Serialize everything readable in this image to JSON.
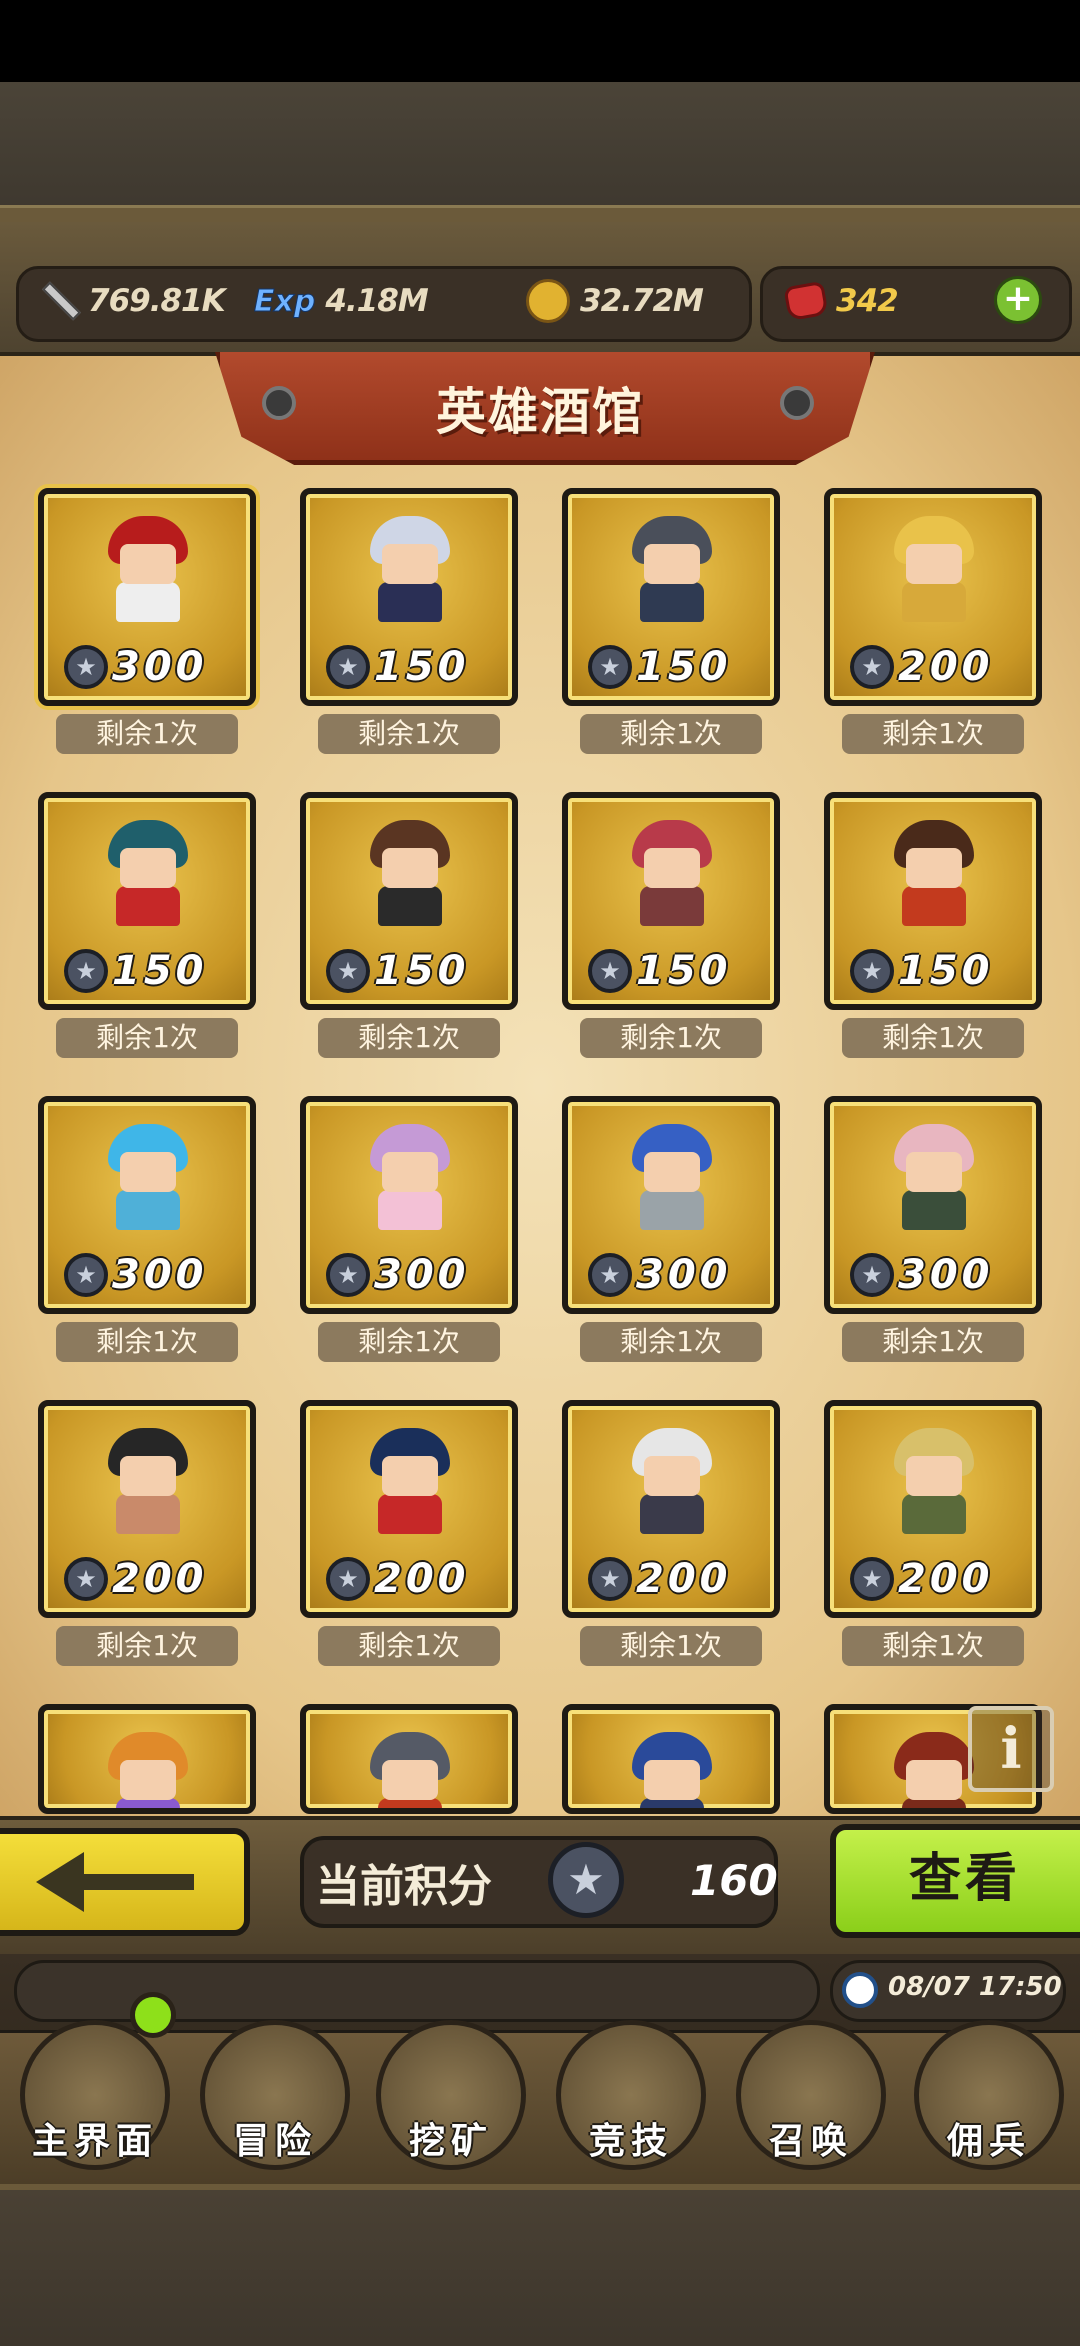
{
  "resources": {
    "attack": "769.81K",
    "exp_icon": "Exp",
    "exp": "4.18M",
    "gold": "32.72M",
    "gems": "342"
  },
  "title": "英雄酒馆",
  "heroes": [
    {
      "price": "300",
      "remaining": "剩余1次",
      "hair": "#b71c1c",
      "body": "#eeeeee"
    },
    {
      "price": "150",
      "remaining": "剩余1次",
      "hair": "#cfd6e6",
      "body": "#2a2f55"
    },
    {
      "price": "150",
      "remaining": "剩余1次",
      "hair": "#4a4f5a",
      "body": "#2f3a52"
    },
    {
      "price": "200",
      "remaining": "剩余1次",
      "hair": "#e9c24a",
      "body": "#d7a93a"
    },
    {
      "price": "150",
      "remaining": "剩余1次",
      "hair": "#1f5f6b",
      "body": "#c62828"
    },
    {
      "price": "150",
      "remaining": "剩余1次",
      "hair": "#5a3522",
      "body": "#2a2a2a"
    },
    {
      "price": "150",
      "remaining": "剩余1次",
      "hair": "#b83a4a",
      "body": "#7a3a3a"
    },
    {
      "price": "150",
      "remaining": "剩余1次",
      "hair": "#4a2a1a",
      "body": "#c33a1e"
    },
    {
      "price": "300",
      "remaining": "剩余1次",
      "hair": "#3fb6e8",
      "body": "#4fb0d8"
    },
    {
      "price": "300",
      "remaining": "剩余1次",
      "hair": "#c59ad6",
      "body": "#f3c1d6"
    },
    {
      "price": "300",
      "remaining": "剩余1次",
      "hair": "#3660c4",
      "body": "#9aa3a8"
    },
    {
      "price": "300",
      "remaining": "剩余1次",
      "hair": "#e8b6c0",
      "body": "#3a4e3a"
    },
    {
      "price": "200",
      "remaining": "剩余1次",
      "hair": "#262626",
      "body": "#c98a6a"
    },
    {
      "price": "200",
      "remaining": "剩余1次",
      "hair": "#1a2f5a",
      "body": "#c62828"
    },
    {
      "price": "200",
      "remaining": "剩余1次",
      "hair": "#e6e6e6",
      "body": "#3a3a4a"
    },
    {
      "price": "200",
      "remaining": "剩余1次",
      "hair": "#d8c06a",
      "body": "#5a6a3a"
    },
    {
      "price": "",
      "remaining": "",
      "hair": "#e08a2a",
      "body": "#8a5ad0"
    },
    {
      "price": "",
      "remaining": "",
      "hair": "#555a66",
      "body": "#c33a1e"
    },
    {
      "price": "",
      "remaining": "",
      "hair": "#2a4a9a",
      "body": "#2a3a6a"
    },
    {
      "price": "",
      "remaining": "",
      "hair": "#8a2a1a",
      "body": "#7a2a1a"
    }
  ],
  "info_icon": "i",
  "footer": {
    "score_label": "当前积分",
    "score_value": "160",
    "view_button": "查看",
    "datetime": "08/07 17:50"
  },
  "nav": [
    {
      "label": "主界面"
    },
    {
      "label": "冒险"
    },
    {
      "label": "挖矿"
    },
    {
      "label": "竞技"
    },
    {
      "label": "召唤"
    },
    {
      "label": "佣兵"
    }
  ],
  "icons": {
    "currency": "star-medal-icon",
    "accent_green": "#8bcf1a",
    "accent_yellow": "#f4de3a"
  }
}
